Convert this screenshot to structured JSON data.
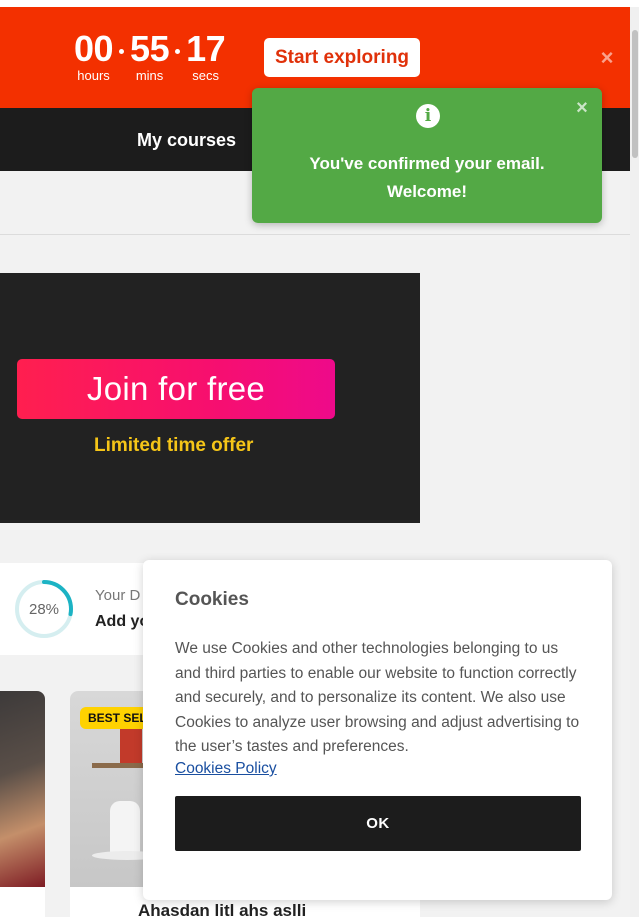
{
  "promo": {
    "hours_value": "00",
    "hours_label": "hours",
    "mins_value": "55",
    "mins_label": "mins",
    "secs_value": "17",
    "secs_label": "secs",
    "cta_label": "Start exploring",
    "close_glyph": "×",
    "bg_color": "#f33000"
  },
  "nav": {
    "my_courses_label": "My courses"
  },
  "toast": {
    "icon": "info-icon",
    "icon_glyph": "i",
    "close_glyph": "×",
    "message": "You've confirmed your email. Welcome!",
    "bg_color": "#53a945"
  },
  "banner": {
    "join_label": "Join for free",
    "offer_text": "Limited time offer"
  },
  "progress_card": {
    "percent_text": "28%",
    "percent": 28,
    "line1": "Your D",
    "line2": "Add yo"
  },
  "courses": {
    "badge_text": "BEST SELLER",
    "tile2_title": "Ahasdan litl ahs aslli"
  },
  "cookies": {
    "title": "Cookies",
    "body": "We use Cookies and other technologies belonging to us and third parties to enable our website to function correctly and securely, and to personalize its content. We also use Cookies to analyze user browsing and adjust advertising to the user’s tastes and preferences.",
    "policy_link": "Cookies Policy",
    "ok_label": "OK"
  }
}
